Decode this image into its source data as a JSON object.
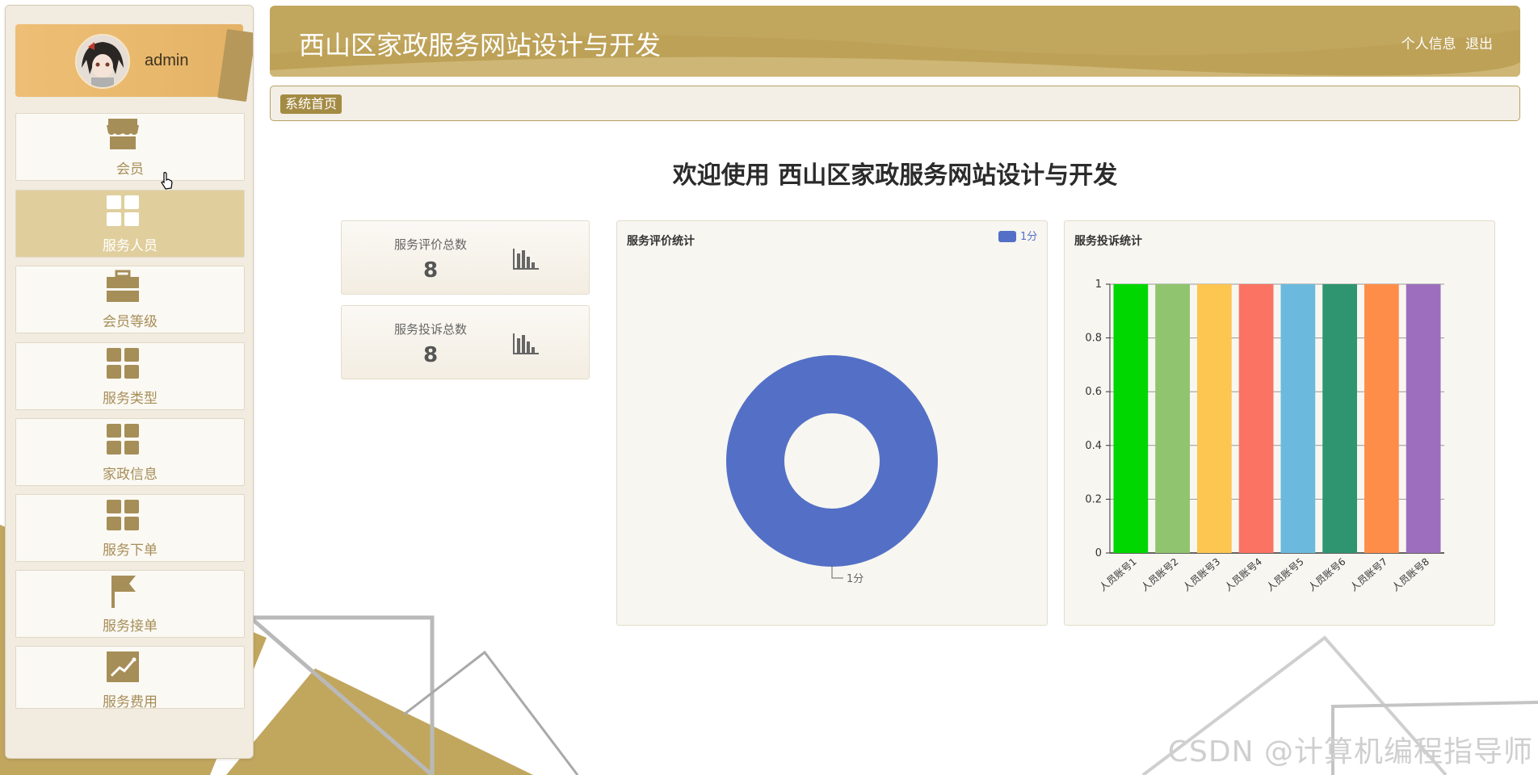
{
  "app": {
    "title": "西山区家政服务网站设计与开发",
    "user_links": [
      "个人信息",
      "退出"
    ]
  },
  "sidebar": {
    "username": "admin",
    "items": [
      {
        "label": "会员",
        "icon": "store-icon",
        "active": false
      },
      {
        "label": "服务人员",
        "icon": "grid-icon",
        "active": true
      },
      {
        "label": "会员等级",
        "icon": "briefcase-icon",
        "active": false
      },
      {
        "label": "服务类型",
        "icon": "grid-icon",
        "active": false
      },
      {
        "label": "家政信息",
        "icon": "grid-icon",
        "active": false
      },
      {
        "label": "服务下单",
        "icon": "grid-icon",
        "active": false
      },
      {
        "label": "服务接单",
        "icon": "flag-icon",
        "active": false
      },
      {
        "label": "服务费用",
        "icon": "chart-line-icon",
        "active": false
      }
    ]
  },
  "breadcrumb": [
    "系统首页"
  ],
  "welcome": "欢迎使用 西山区家政服务网站设计与开发",
  "stats": [
    {
      "label": "服务评价总数",
      "value": "8",
      "icon": "bar-chart-icon"
    },
    {
      "label": "服务投诉总数",
      "value": "8",
      "icon": "bar-chart-icon"
    }
  ],
  "chart_data": [
    {
      "type": "pie",
      "title": "服务评价统计",
      "donut": true,
      "legend_position": "top-right",
      "slices": [
        {
          "name": "1分",
          "value": 8,
          "color": "#5470c6"
        }
      ]
    },
    {
      "type": "bar",
      "title": "服务投诉统计",
      "categories": [
        "人员账号1",
        "人员账号2",
        "人员账号3",
        "人员账号4",
        "人员账号5",
        "人员账号6",
        "人员账号7",
        "人员账号8"
      ],
      "values": [
        1,
        1,
        1,
        1,
        1,
        1,
        1,
        1
      ],
      "colors": [
        "#00d700",
        "#91c46f",
        "#fcc651",
        "#fa7363",
        "#6cb9de",
        "#2f9570",
        "#fe8d49",
        "#9d6ebd"
      ],
      "ylim": [
        0,
        1
      ],
      "yticks": [
        "0",
        "0.2",
        "0.4",
        "0.6",
        "0.8",
        "1"
      ],
      "grid": true
    }
  ],
  "watermark": "CSDN @计算机编程指导师"
}
